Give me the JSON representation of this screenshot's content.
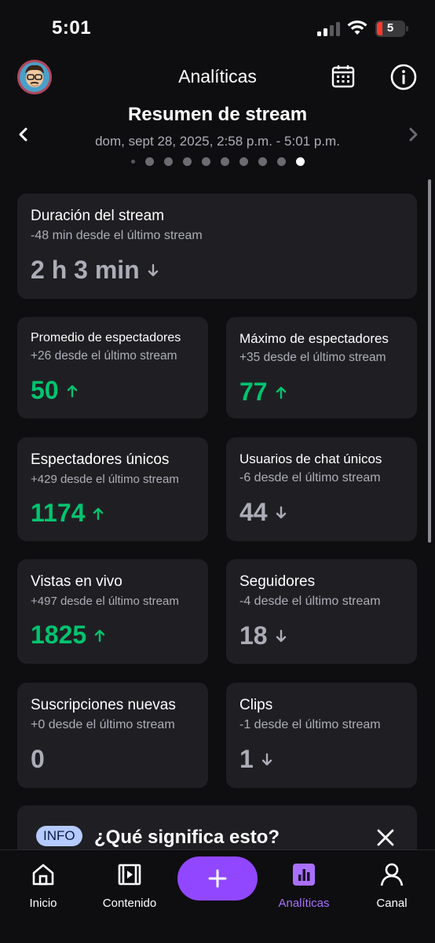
{
  "status": {
    "time": "5:01",
    "battery": "5"
  },
  "header": {
    "title": "Analíticas"
  },
  "summary": {
    "title": "Resumen de stream",
    "date": "dom, sept 28, 2025, 2:58 p.m. - 5:01 p.m."
  },
  "cards": {
    "duration": {
      "label": "Duración del stream",
      "sub": "-48 min desde el último stream",
      "value": "2 h 3 min",
      "trend": "down"
    },
    "avg_viewers": {
      "label": "Promedio de espectadores",
      "sub": "+26 desde el último stream",
      "value": "50",
      "trend": "up"
    },
    "max_viewers": {
      "label": "Máximo de espectadores",
      "sub": "+35 desde el último stream",
      "value": "77",
      "trend": "up"
    },
    "unique_viewers": {
      "label": "Espectadores únicos",
      "sub": "+429 desde el último stream",
      "value": "1174",
      "trend": "up"
    },
    "unique_chatters": {
      "label": "Usuarios de chat únicos",
      "sub": "-6 desde el último stream",
      "value": "44",
      "trend": "down"
    },
    "live_views": {
      "label": "Vistas en vivo",
      "sub": "+497 desde el último stream",
      "value": "1825",
      "trend": "up"
    },
    "followers": {
      "label": "Seguidores",
      "sub": "-4 desde el último stream",
      "value": "18",
      "trend": "down"
    },
    "new_subs": {
      "label": "Suscripciones nuevas",
      "sub": "+0 desde el último stream",
      "value": "0",
      "trend": "neutral"
    },
    "clips": {
      "label": "Clips",
      "sub": "-1 desde el último stream",
      "value": "1",
      "trend": "down"
    }
  },
  "info": {
    "badge": "INFO",
    "title": "¿Qué significa esto?"
  },
  "nav": {
    "home": "Inicio",
    "content": "Contenido",
    "analytics": "Analíticas",
    "channel": "Canal"
  },
  "colors": {
    "accent": "#9147ff",
    "up": "#00c46f",
    "muted": "#adadb8",
    "card": "#1f1f23"
  }
}
